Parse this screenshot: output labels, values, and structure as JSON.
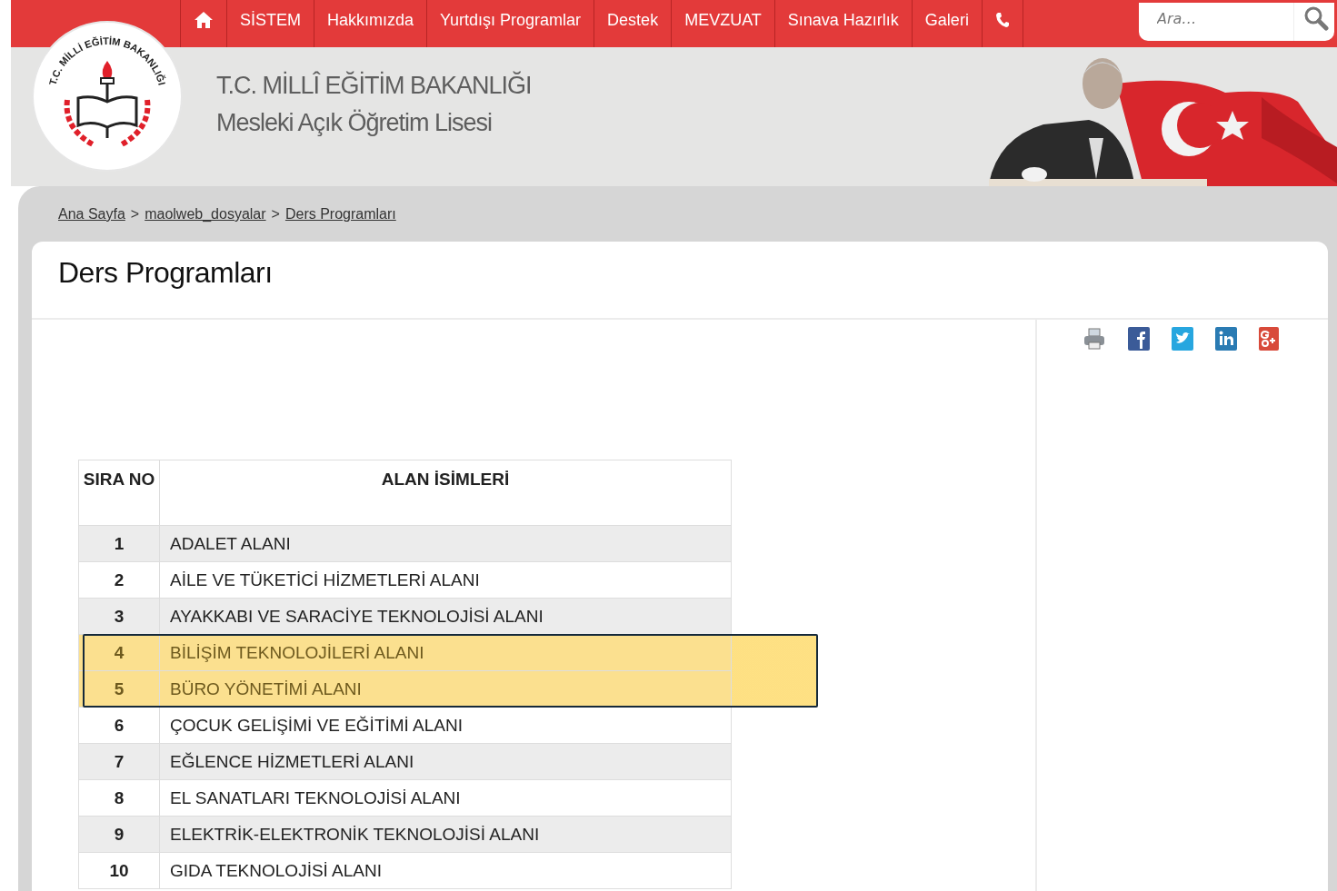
{
  "logo": {
    "ring_text": "T.C. MİLLİ EĞİTİM BAKANLIĞI"
  },
  "nav": {
    "items": [
      "SİSTEM",
      "Hakkımızda",
      "Yurtdışı Programlar",
      "Destek",
      "MEVZUAT",
      "Sınava Hazırlık",
      "Galeri"
    ]
  },
  "search": {
    "placeholder": "Ara…"
  },
  "header": {
    "title": "T.C. MİLLÎ EĞİTİM BAKANLIĞI",
    "subtitle": "Mesleki Açık Öğretim Lisesi"
  },
  "breadcrumb": {
    "separator": ">",
    "items": [
      "Ana Sayfa",
      "maolweb_dosyalar",
      "Ders Programları"
    ]
  },
  "page_title": "Ders Programları",
  "table": {
    "columns": [
      "SIRA NO",
      "ALAN İSİMLERİ"
    ],
    "rows": [
      {
        "no": "1",
        "name": "ADALET ALANI",
        "highlighted": false
      },
      {
        "no": "2",
        "name": "AİLE VE TÜKETİCİ HİZMETLERİ ALANI",
        "highlighted": false
      },
      {
        "no": "3",
        "name": "AYAKKABI VE SARACİYE TEKNOLOJİSİ ALANI",
        "highlighted": false
      },
      {
        "no": "4",
        "name": "BİLİŞİM TEKNOLOJİLERİ ALANI",
        "highlighted": true
      },
      {
        "no": "5",
        "name": "BÜRO YÖNETİMİ ALANI",
        "highlighted": true
      },
      {
        "no": "6",
        "name": "ÇOCUK GELİŞİMİ VE EĞİTİMİ ALANI",
        "highlighted": false
      },
      {
        "no": "7",
        "name": "EĞLENCE HİZMETLERİ ALANI",
        "highlighted": false
      },
      {
        "no": "8",
        "name": "EL SANATLARI TEKNOLOJİSİ ALANI",
        "highlighted": false
      },
      {
        "no": "9",
        "name": "ELEKTRİK-ELEKTRONİK TEKNOLOJİSİ ALANI",
        "highlighted": false
      },
      {
        "no": "10",
        "name": "GIDA TEKNOLOJİSİ ALANI",
        "highlighted": false
      }
    ]
  }
}
